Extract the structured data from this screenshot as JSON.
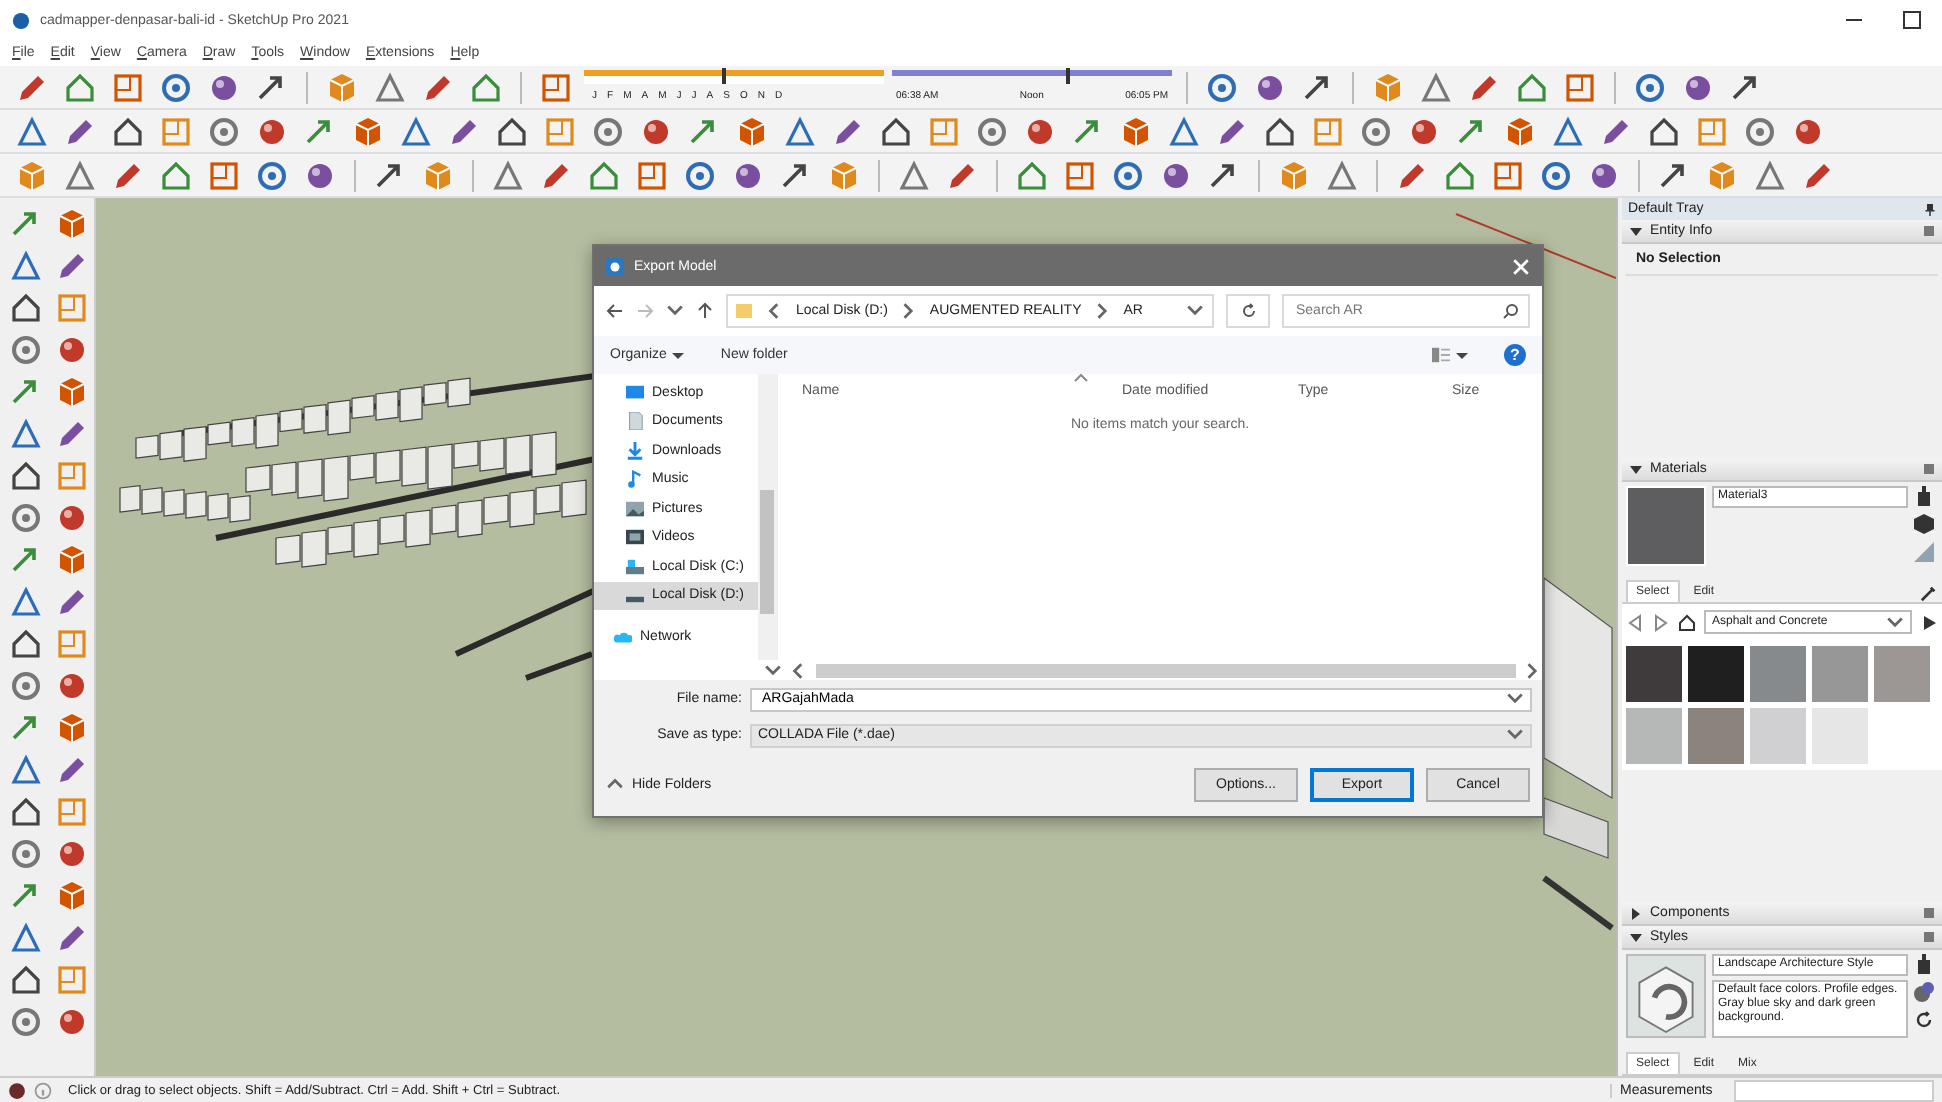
{
  "window": {
    "title": "cadmapper-denpasar-bali-id - SketchUp Pro 2021"
  },
  "menu": [
    "File",
    "Edit",
    "View",
    "Camera",
    "Draw",
    "Tools",
    "Window",
    "Extensions",
    "Help"
  ],
  "shadow_settings": {
    "month_slider": {
      "level": 0.46,
      "labels": [
        "J",
        "F",
        "M",
        "A",
        "M",
        "J",
        "J",
        "A",
        "S",
        "O",
        "N",
        "D"
      ]
    },
    "time_slider": {
      "level": 0.62,
      "labels": [
        "06:38 AM",
        "Noon",
        "06:05 PM"
      ]
    }
  },
  "dialog": {
    "title": "Export Model",
    "path": [
      "Local Disk (D:)",
      "AUGMENTED REALITY",
      "AR"
    ],
    "search": {
      "placeholder": "Search AR"
    },
    "commands": {
      "organize": "Organize",
      "new_folder": "New folder",
      "help": "?"
    },
    "nav": [
      {
        "kind": "desktop",
        "label": "Desktop",
        "selected": false
      },
      {
        "kind": "documents",
        "label": "Documents",
        "selected": false
      },
      {
        "kind": "downloads",
        "label": "Downloads",
        "selected": false
      },
      {
        "kind": "music",
        "label": "Music",
        "selected": false
      },
      {
        "kind": "pictures",
        "label": "Pictures",
        "selected": false
      },
      {
        "kind": "videos",
        "label": "Videos",
        "selected": false
      },
      {
        "kind": "system_drive",
        "label": "Local Disk (C:)",
        "selected": false
      },
      {
        "kind": "drive",
        "label": "Local Disk (D:)",
        "selected": true
      },
      {
        "kind": "network",
        "label": "Network",
        "selected": false
      }
    ],
    "columns": [
      "Name",
      "Date modified",
      "Type",
      "Size"
    ],
    "empty_message": "No items match your search.",
    "file_name": {
      "label": "File name:",
      "value": "ARGajahMada"
    },
    "save_as_type": {
      "label": "Save as type:",
      "value": "COLLADA File (*.dae)"
    },
    "hide_folders": "Hide Folders",
    "buttons": [
      {
        "label": "Options...",
        "default": false
      },
      {
        "label": "Export",
        "default": true
      },
      {
        "label": "Cancel",
        "default": false
      }
    ]
  },
  "tray": {
    "title": "Default Tray",
    "entity_info": {
      "title": "Entity Info",
      "expanded": true,
      "text": "No Selection"
    },
    "materials": {
      "title": "Materials",
      "expanded": true,
      "name": "Material3",
      "tabs": [
        {
          "label": "Select",
          "selected": true
        },
        {
          "label": "Edit",
          "selected": false
        }
      ],
      "collection": "Asphalt and Concrete",
      "swatches": [
        {
          "color": "#3f3a3b"
        },
        {
          "color": "#1f1f1f"
        },
        {
          "color": "#878a8d"
        },
        {
          "color": "#979797"
        },
        {
          "color": "#9c9795"
        },
        {
          "color": "#b5b8b6"
        },
        {
          "color": "#8a837e"
        },
        {
          "color": "#d0d0d2"
        },
        {
          "color": "#e6e6e6"
        }
      ]
    },
    "components": {
      "title": "Components",
      "expanded": false
    },
    "styles": {
      "title": "Styles",
      "expanded": true,
      "name": "Landscape Architecture Style",
      "description": "Default face colors. Profile edges. Gray blue sky and dark green background.",
      "tabs": [
        {
          "label": "Select",
          "selected": true
        },
        {
          "label": "Edit",
          "selected": false
        },
        {
          "label": "Mix",
          "selected": false
        }
      ]
    }
  },
  "status_bar": {
    "message": "Click or drag to select objects. Shift = Add/Subtract. Ctrl = Add. Shift + Ctrl = Subtract.",
    "measurements_label": "Measurements"
  }
}
